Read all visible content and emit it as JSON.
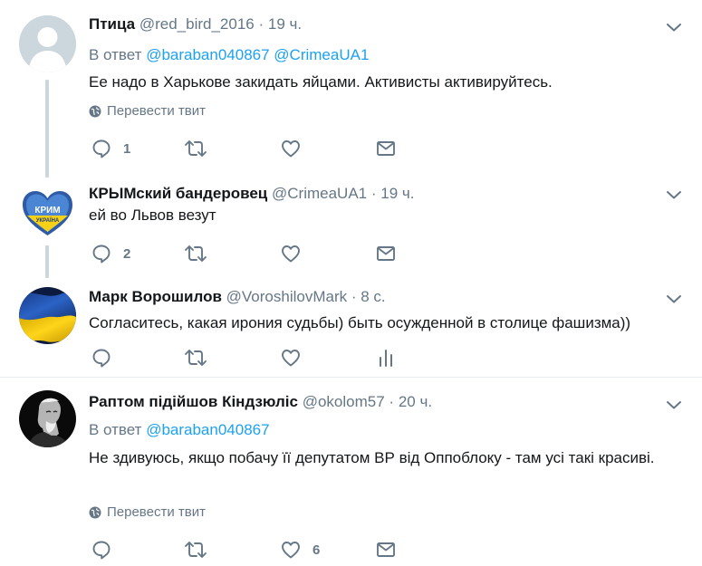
{
  "tweets": [
    {
      "name": "Птица",
      "handle": "@red_bird_2016",
      "dot": "·",
      "time": "19 ч.",
      "reply_prefix": "В ответ",
      "mentions": [
        "@baraban040867",
        "@CrimeaUA1"
      ],
      "text": "Ее надо в Харькове закидать яйцами. Активисты активируйтесь.",
      "translate": "Перевести твит",
      "reply_count": "1",
      "retweet_count": "",
      "like_count": "",
      "avatar_icon": "default-profile-icon"
    },
    {
      "name": "КРЫМский бандеровец",
      "handle": "@CrimeaUA1",
      "dot": "·",
      "time": "19 ч.",
      "text": "ей во Львов везут",
      "reply_count": "2",
      "avatar_icon": "crimea-heart-logo",
      "avatar_text_top": "КРИМ",
      "avatar_text_bottom": "УКРАЇНА"
    },
    {
      "name": "Марк Ворошилов",
      "handle": "@VoroshilovMark",
      "dot": "·",
      "time": "8 с.",
      "text": "Согласитесь, какая ирония судьбы) быть осужденной в столице фашизма))",
      "avatar_icon": "ukraine-flag-avatar"
    },
    {
      "name": "Раптом підійшов Кіндзюліс",
      "handle": "@okolom57",
      "dot": "·",
      "time": "20 ч.",
      "reply_prefix": "В ответ",
      "mentions": [
        "@baraban040867"
      ],
      "text": "Не здивуюсь, якщо побачу її депутатом ВР від Оппоблоку - там усі такі красиві.",
      "translate": "Перевести твит",
      "like_count": "6",
      "avatar_icon": "bw-portrait-avatar"
    }
  ],
  "colors": {
    "link": "#1da1f2",
    "muted": "#657786",
    "text": "#14171a",
    "thread_line": "#ccd6dd",
    "divider": "#e6ecf0"
  }
}
